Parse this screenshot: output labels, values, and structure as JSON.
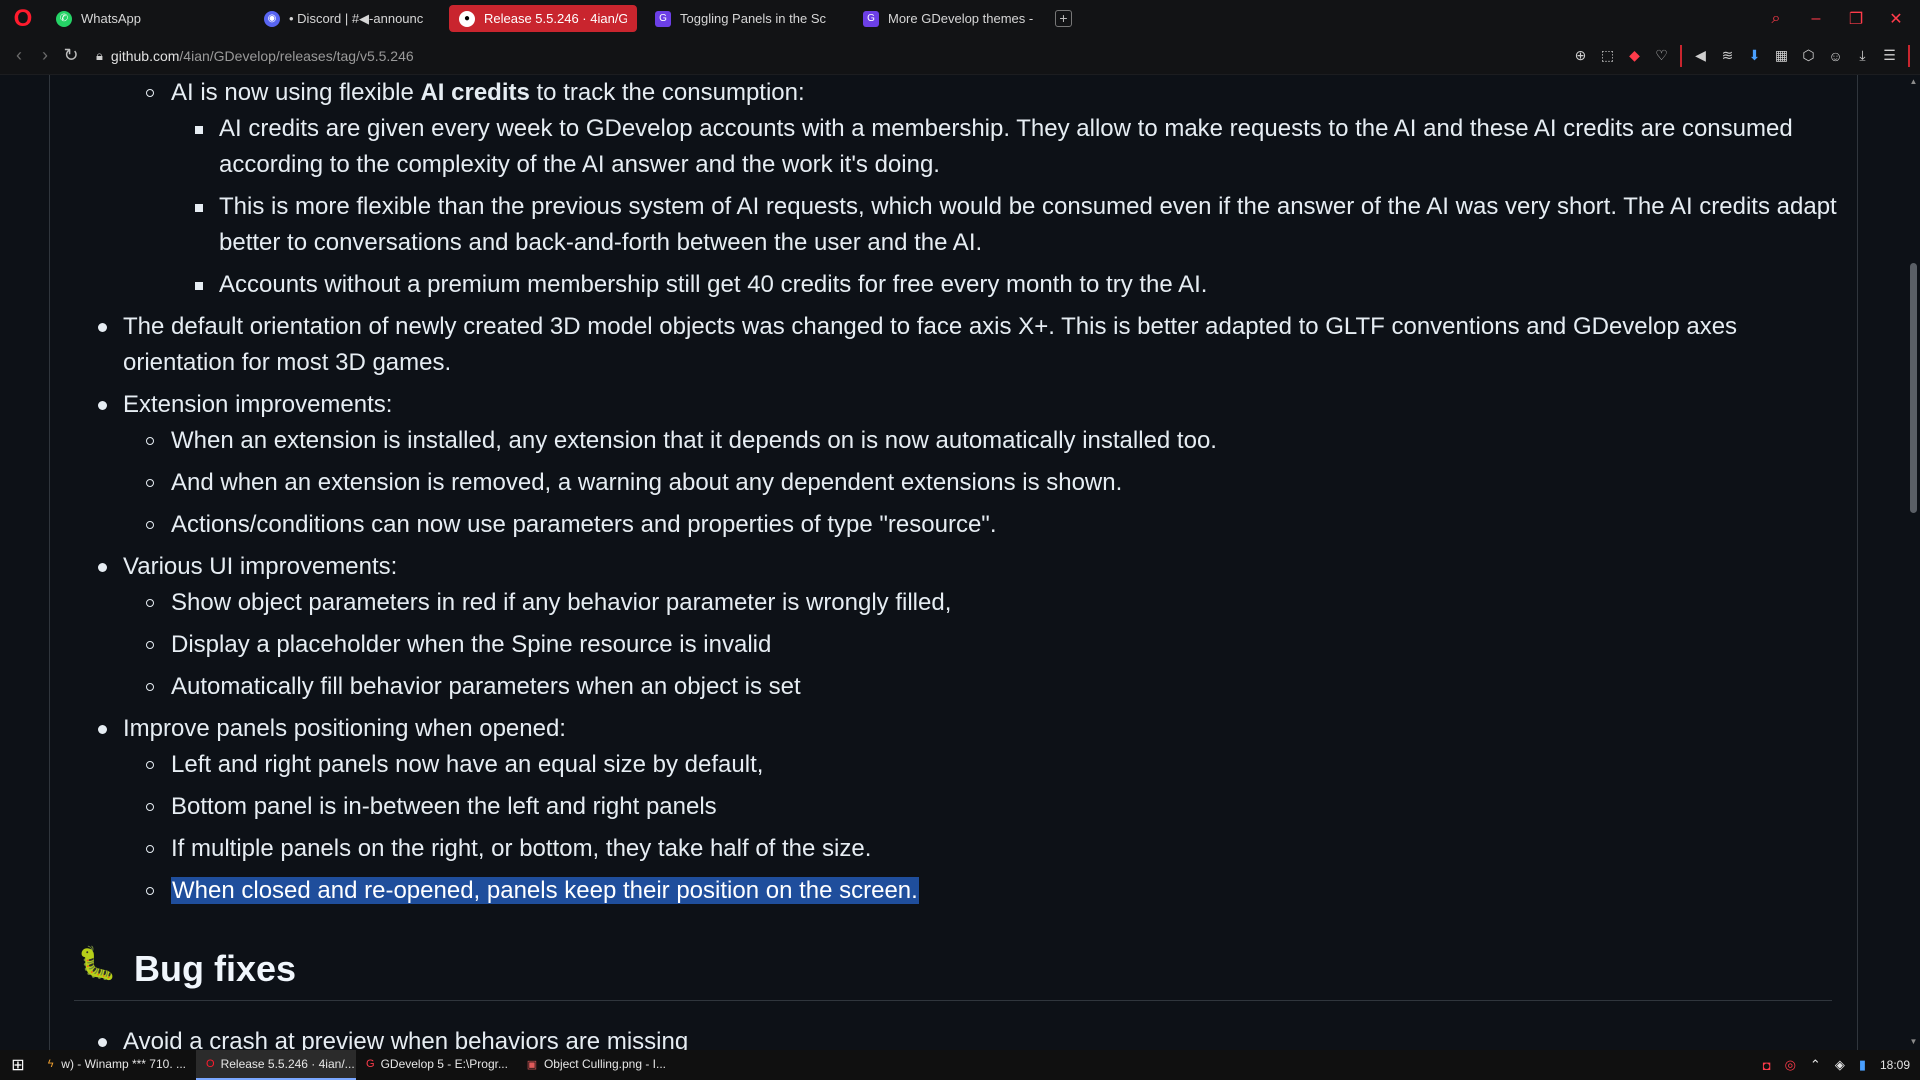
{
  "browser": {
    "tabs": [
      {
        "label": "WhatsApp",
        "icon": "whatsapp-icon",
        "active": false
      },
      {
        "label": "• Discord | #◀-announc",
        "icon": "discord-icon",
        "active": false
      },
      {
        "label": "Release 5.5.246 · 4ian/G",
        "icon": "github-icon",
        "active": true
      },
      {
        "label": "Toggling Panels in the Sc",
        "icon": "gdevelop-icon",
        "active": false
      },
      {
        "label": "More GDevelop themes -",
        "icon": "gdevelop-icon",
        "active": false
      }
    ],
    "new_tab": "+",
    "url_host": "github.com",
    "url_path": "/4ian/GDevelop/releases/tag/v5.5.246",
    "accent": "#c9252e"
  },
  "content": {
    "items": [
      {
        "text_prefix": "AI is now using flexible ",
        "text_bold": "AI credits",
        "text_suffix": " to track the consumption:"
      },
      {
        "text": "AI credits are given every week to GDevelop accounts with a membership. They allow to make requests to the AI and these AI credits are consumed"
      },
      {
        "text": "according to the complexity of the AI answer and the work it's doing."
      },
      {
        "text": "This is more flexible than the previous system of AI requests, which would be consumed even if the answer of the AI was very short. The AI credits adapt"
      },
      {
        "text": "better to conversations and back-and-forth between the user and the AI."
      },
      {
        "text": "Accounts without a premium membership still get 40 credits for free every month to try the AI."
      },
      {
        "text": "The default orientation of newly created 3D model objects was changed to face axis X+. This is better adapted to GLTF conventions and GDevelop axes"
      },
      {
        "text": "orientation for most 3D games."
      },
      {
        "text": "Extension improvements:"
      },
      {
        "text": "When an extension is installed, any extension that it depends on is now automatically installed too."
      },
      {
        "text": "And when an extension is removed, a warning about any dependent extensions is shown."
      },
      {
        "text": "Actions/conditions can now use parameters and properties of type \"resource\"."
      },
      {
        "text": "Various UI improvements:"
      },
      {
        "text": "Show object parameters in red if any behavior parameter is wrongly filled,"
      },
      {
        "text": "Display a placeholder when the Spine resource is invalid"
      },
      {
        "text": "Automatically fill behavior parameters when an object is set"
      },
      {
        "text": "Improve panels positioning when opened:"
      },
      {
        "text": "Left and right panels now have an equal size by default,"
      },
      {
        "text": "Bottom panel is in-between the left and right panels"
      },
      {
        "text": "If multiple panels on the right, or bottom, they take half of the size."
      },
      {
        "text": "When closed and re-opened, panels keep their position on the screen."
      }
    ],
    "bug_fixes_title": "Bug fixes",
    "bug_fixes_icon": "🐛",
    "bug_fixes_first": "Avoid a crash at preview when behaviors are missing"
  },
  "taskbar": {
    "tasks": [
      {
        "label": "w) - Winamp *** 710. ...",
        "icon": "winamp-icon",
        "active": false
      },
      {
        "label": "Release 5.5.246 · 4ian/...",
        "icon": "opera-icon",
        "active": true
      },
      {
        "label": "GDevelop 5 - E:\\Progr...",
        "icon": "gdevelop-icon",
        "active": false
      },
      {
        "label": "Object Culling.png - I...",
        "icon": "image-editor-icon",
        "active": false
      }
    ],
    "clock": "18:09"
  }
}
